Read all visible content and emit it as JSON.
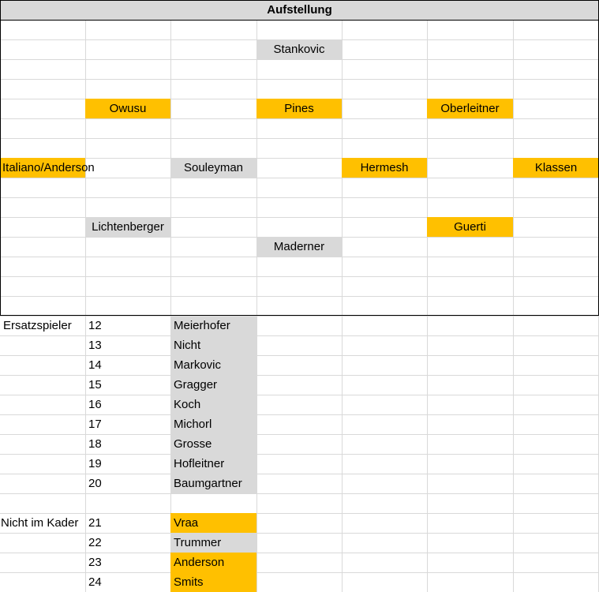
{
  "title": "Aufstellung",
  "colors": {
    "orange": "#ffc000",
    "gray": "#d9d9d9",
    "grid": "#d9d9d9",
    "border": "#000000"
  },
  "formation": {
    "stankovic": "Stankovic",
    "owusu": "Owusu",
    "pines": "Pines",
    "oberleitner": "Oberleitner",
    "italiano_anderson": "Italiano/Anderson",
    "souleyman": "Souleyman",
    "hermesh": "Hermesh",
    "klassen": "Klassen",
    "lichtenberger": "Lichtenberger",
    "guerti": "Guerti",
    "maderner": "Maderner"
  },
  "substitutes": {
    "label": "Ersatzspieler",
    "players": [
      {
        "number": "12",
        "name": "Meierhofer"
      },
      {
        "number": "13",
        "name": "Nicht"
      },
      {
        "number": "14",
        "name": "Markovic"
      },
      {
        "number": "15",
        "name": "Gragger"
      },
      {
        "number": "16",
        "name": "Koch"
      },
      {
        "number": "17",
        "name": "Michorl"
      },
      {
        "number": "18",
        "name": "Grosse"
      },
      {
        "number": "19",
        "name": "Hofleitner"
      },
      {
        "number": "20",
        "name": "Baumgartner"
      }
    ]
  },
  "not_in_squad": {
    "label": "Nicht im Kader",
    "players": [
      {
        "number": "21",
        "name": "Vraa",
        "highlight": "orange"
      },
      {
        "number": "22",
        "name": "Trummer",
        "highlight": "gray"
      },
      {
        "number": "23",
        "name": "Anderson",
        "highlight": "orange"
      },
      {
        "number": "24",
        "name": "Smits",
        "highlight": "orange"
      }
    ]
  }
}
